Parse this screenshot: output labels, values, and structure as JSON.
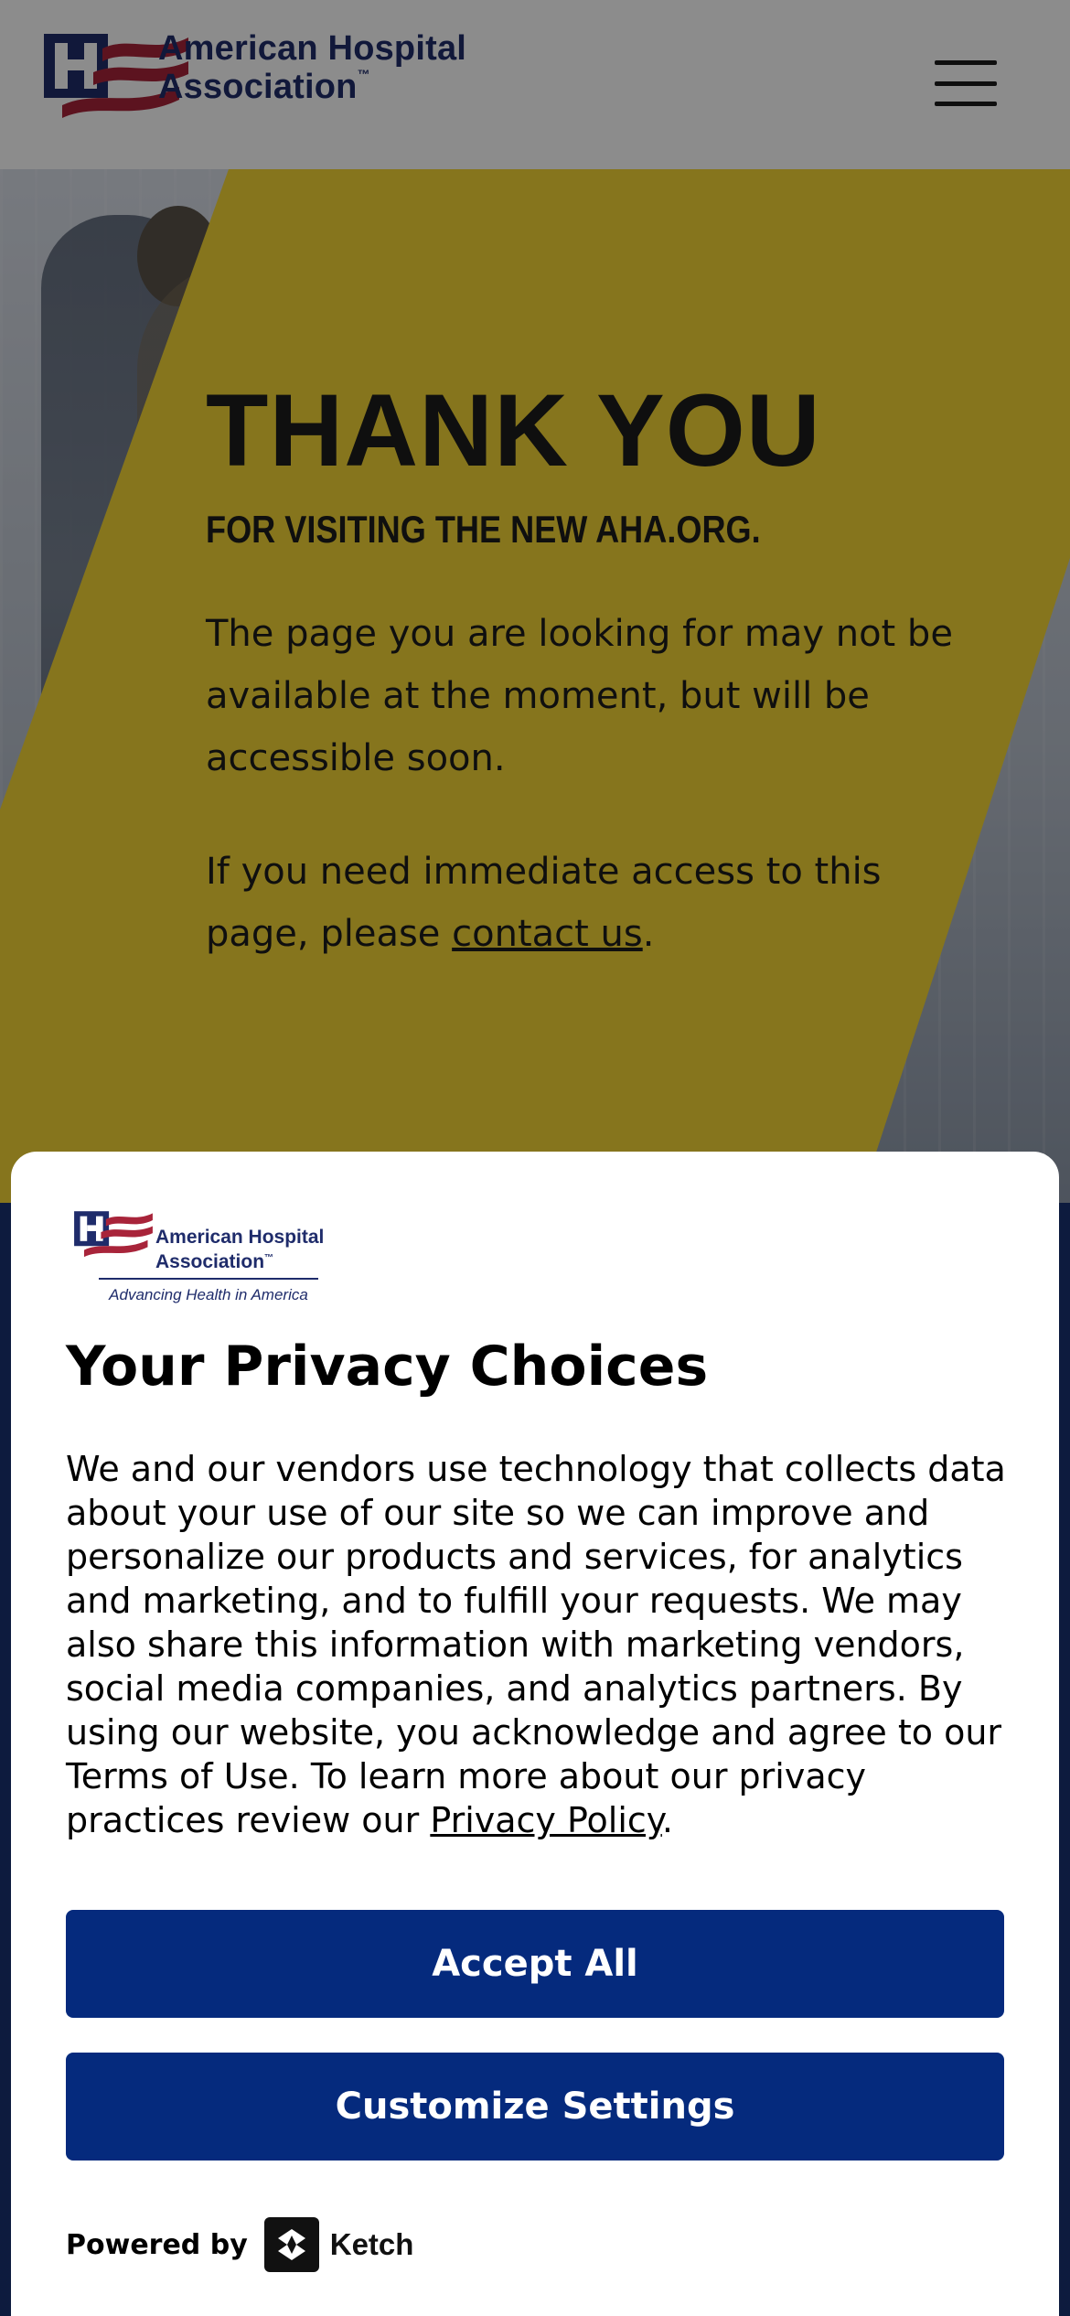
{
  "header": {
    "logo_line1": "American Hospital",
    "logo_line2": "Association",
    "logo_tm": "™",
    "menu_icon": "hamburger-menu-icon"
  },
  "hero": {
    "title": "THANK YOU",
    "subtitle": "FOR VISITING THE NEW AHA.ORG.",
    "para1": "The page you are looking for may not be available at the moment, but will be accessible soon.",
    "para2_prefix": "If you need immediate access to this page, please ",
    "para2_link": "contact us",
    "para2_suffix": "."
  },
  "privacy_modal": {
    "logo_line1": "American Hospital",
    "logo_line2": "Association",
    "logo_tm": "™",
    "logo_tagline": "Advancing Health in America",
    "title": "Your Privacy Choices",
    "body_text": "We and our vendors use technology that collects data about your use of our site so we can improve and personalize our products and services, for analytics and marketing, and to fulfill your requests. We may also share this information with marketing vendors, social media companies, and analytics partners. By using our website, you acknowledge and agree to our Terms of Use. To learn more about our privacy practices review our ",
    "privacy_link": "Privacy Policy",
    "body_suffix": ".",
    "accept_label": "Accept All",
    "customize_label": "Customize Settings",
    "powered_by": "Powered by",
    "powered_brand": "Ketch"
  },
  "colors": {
    "brand_navy": "#1f2c6b",
    "button_blue": "#052a7d",
    "hero_yellow": "#f5d635",
    "flag_red": "#a8243a"
  }
}
